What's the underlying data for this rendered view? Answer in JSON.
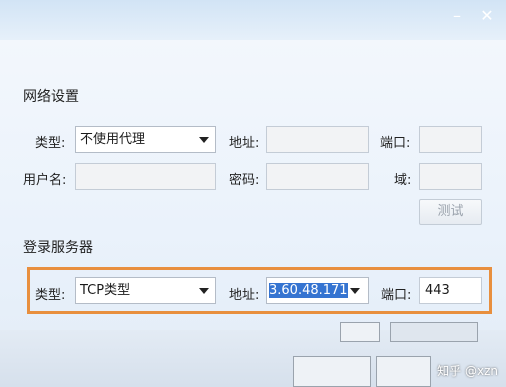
{
  "window": {
    "minimize_glyph": "–",
    "close_glyph": "✕"
  },
  "network": {
    "title": "网络设置",
    "type_label": "类型:",
    "type_value": "不使用代理",
    "address_label": "地址:",
    "port_label": "端口:",
    "username_label": "用户名:",
    "password_label": "密码:",
    "domain_label": "域:",
    "test_button": "测试"
  },
  "server": {
    "title": "登录服务器",
    "type_label": "类型:",
    "type_value": "TCP类型",
    "address_label": "地址:",
    "address_value": "3.60.48.171",
    "port_label": "端口:",
    "port_value": "443"
  },
  "watermark": "知乎 @xzn",
  "colors": {
    "highlight": "#e88f3e",
    "selection": "#3574d1"
  }
}
